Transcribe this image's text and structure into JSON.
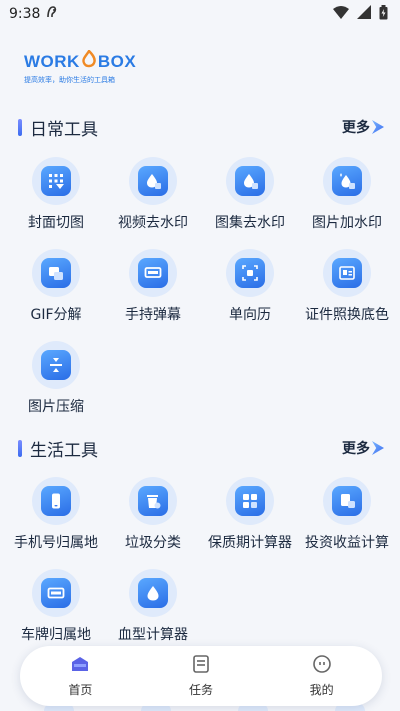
{
  "status": {
    "time": "9:38"
  },
  "brand": {
    "logo_prefix": "WORK",
    "logo_suffix": "BOX",
    "tagline": "提高效率，助你生活的工具箱"
  },
  "sections": [
    {
      "title": "日常工具",
      "more": "更多",
      "items": [
        {
          "label": "封面切图",
          "icon": "grid-crop-icon"
        },
        {
          "label": "视频去水印",
          "icon": "video-drop-icon"
        },
        {
          "label": "图集去水印",
          "icon": "gallery-drop-icon"
        },
        {
          "label": "图片加水印",
          "icon": "image-add-drop-icon"
        },
        {
          "label": "GIF分解",
          "icon": "gif-icon"
        },
        {
          "label": "手持弹幕",
          "icon": "danmaku-icon"
        },
        {
          "label": "单向历",
          "icon": "calendar-icon"
        },
        {
          "label": "证件照换底色",
          "icon": "id-photo-icon"
        },
        {
          "label": "图片压缩",
          "icon": "compress-icon"
        }
      ]
    },
    {
      "title": "生活工具",
      "more": "更多",
      "items": [
        {
          "label": "手机号归属地",
          "icon": "phone-icon"
        },
        {
          "label": "垃圾分类",
          "icon": "trash-icon"
        },
        {
          "label": "保质期计算器",
          "icon": "calculator-icon"
        },
        {
          "label": "投资收益计算",
          "icon": "invest-icon"
        },
        {
          "label": "车牌归属地",
          "icon": "plate-icon"
        },
        {
          "label": "血型计算器",
          "icon": "blood-icon"
        }
      ]
    }
  ],
  "nav": [
    {
      "label": "首页",
      "icon": "home-icon"
    },
    {
      "label": "任务",
      "icon": "task-icon"
    },
    {
      "label": "我的",
      "icon": "profile-icon"
    }
  ]
}
